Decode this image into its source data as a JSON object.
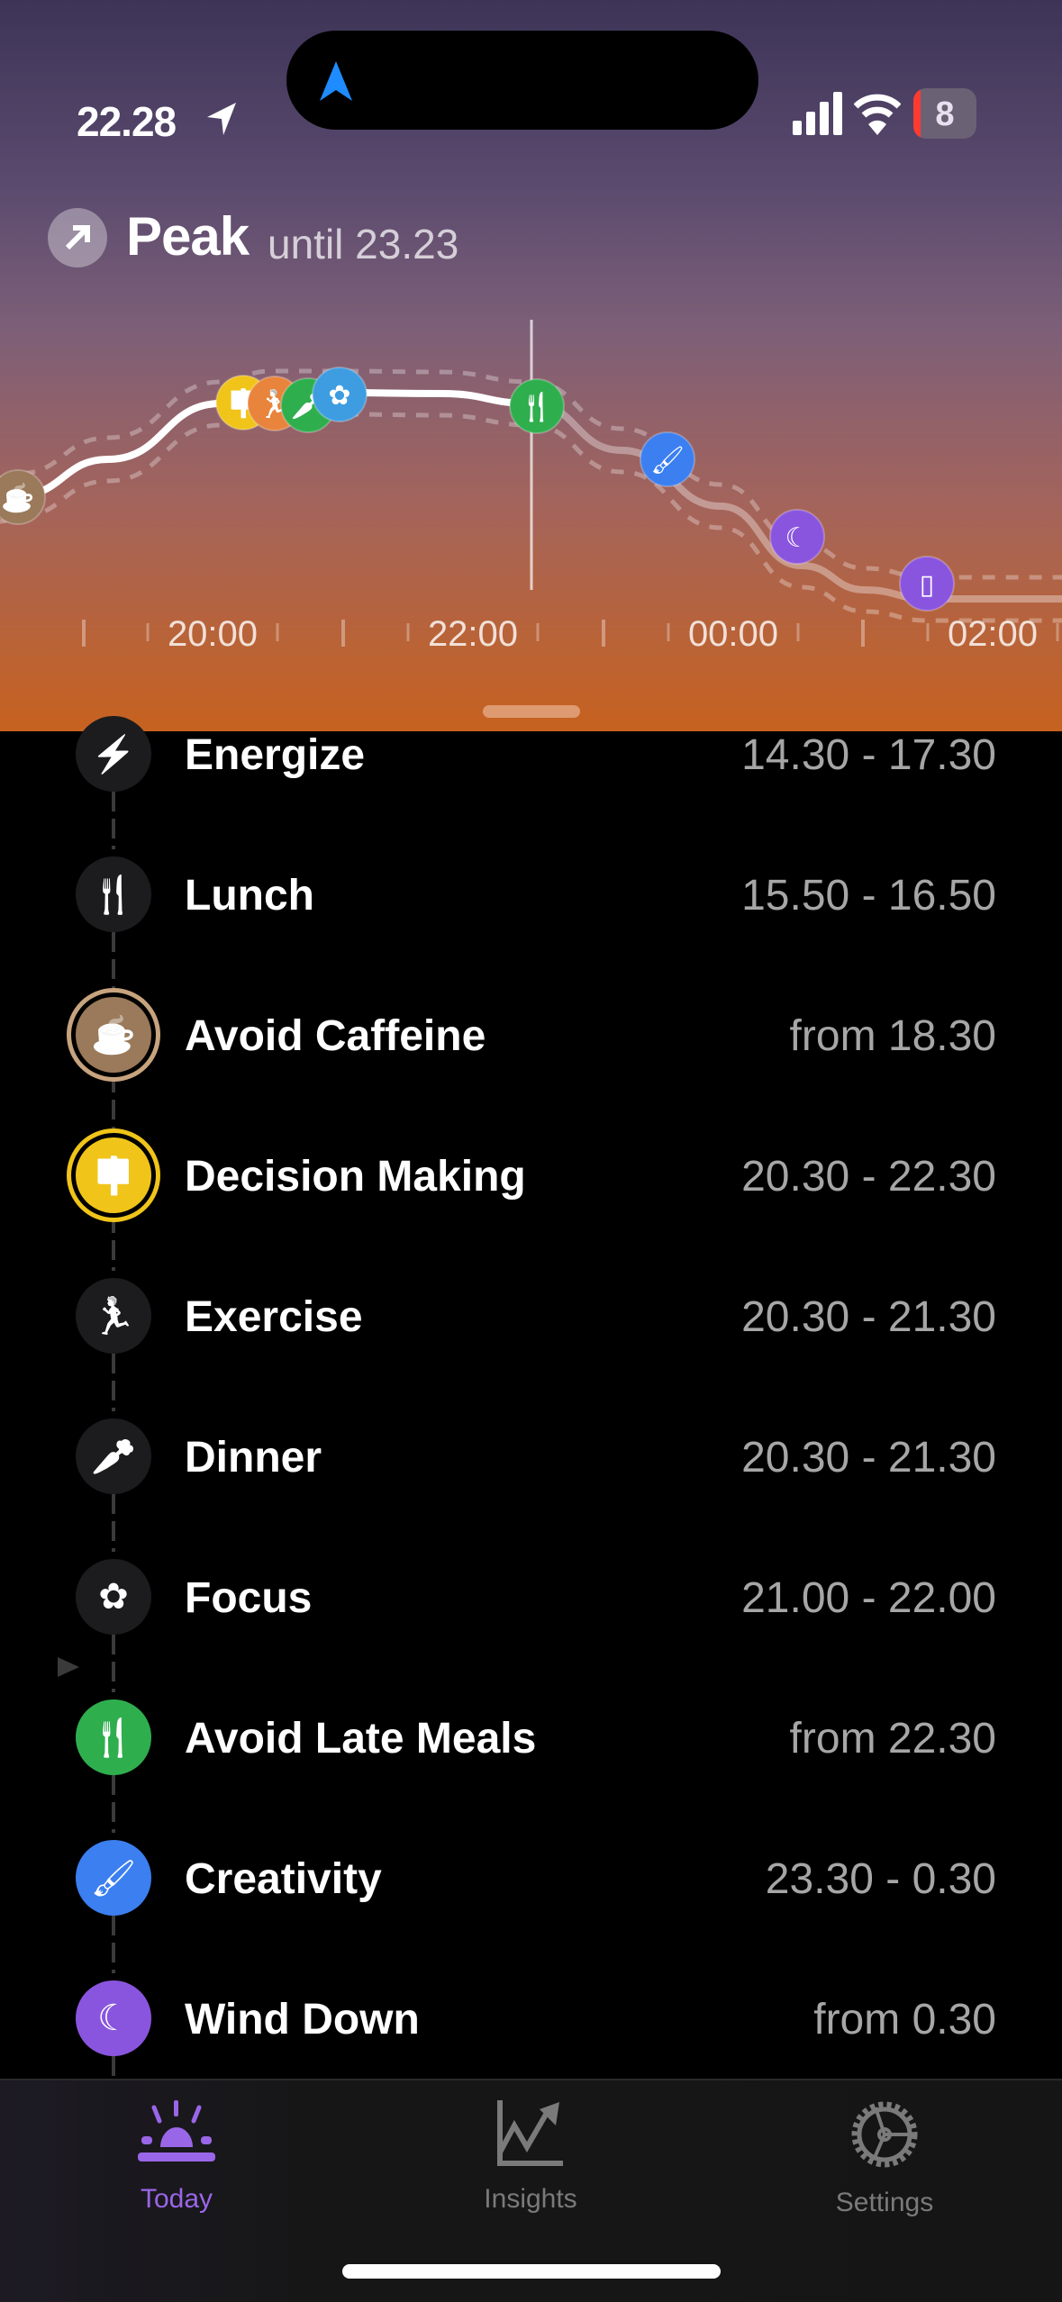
{
  "status_bar": {
    "time": "22.28",
    "battery": "8"
  },
  "header": {
    "title": "Peak",
    "subtitle": "until 23.23"
  },
  "chart": {
    "ticks": [
      "20:00",
      "22:00",
      "00:00",
      "02:00"
    ],
    "now": "22.28",
    "markers": [
      {
        "name": "avoid-caffeine",
        "color": "#9a7a5a",
        "icon": "cup-icon"
      },
      {
        "name": "decision-making",
        "color": "#f0c419",
        "icon": "signpost-icon"
      },
      {
        "name": "exercise",
        "color": "#e8843c",
        "icon": "runner-icon"
      },
      {
        "name": "dinner",
        "color": "#2fae4e",
        "icon": "carrot-icon"
      },
      {
        "name": "focus",
        "color": "#3d9de0",
        "icon": "brain-icon"
      },
      {
        "name": "avoid-late-meals",
        "color": "#2fae4e",
        "icon": "fork-knife-icon"
      },
      {
        "name": "creativity",
        "color": "#3b7ff0",
        "icon": "brush-icon"
      },
      {
        "name": "wind-down",
        "color": "#8a55de",
        "icon": "moon-icon"
      },
      {
        "name": "screen-time",
        "color": "#8a55de",
        "icon": "phone-icon"
      }
    ]
  },
  "list": [
    {
      "label": "Energize",
      "time": "14.30 - 17.30",
      "icon": "bolt-icon",
      "bg": "#1c1c1e"
    },
    {
      "label": "Lunch",
      "time": "15.50 - 16.50",
      "icon": "fork-knife-icon",
      "bg": "#1c1c1e"
    },
    {
      "label": "Avoid Caffeine",
      "time": "from 18.30",
      "icon": "no-cup-icon",
      "bg": "#9a7a5a",
      "ring": "#c7a37e"
    },
    {
      "label": "Decision Making",
      "time": "20.30 - 22.30",
      "icon": "signpost-icon",
      "bg": "#f0c419",
      "ring": "#f0c419"
    },
    {
      "label": "Exercise",
      "time": "20.30 - 21.30",
      "icon": "runner-icon",
      "bg": "#1c1c1e"
    },
    {
      "label": "Dinner",
      "time": "20.30 - 21.30",
      "icon": "carrot-icon",
      "bg": "#1c1c1e"
    },
    {
      "label": "Focus",
      "time": "21.00 - 22.00",
      "icon": "brain-icon",
      "bg": "#1c1c1e"
    },
    {
      "label": "Avoid Late Meals",
      "time": "from 22.30",
      "icon": "no-fork-icon",
      "bg": "#2fae4e"
    },
    {
      "label": "Creativity",
      "time": "23.30 - 0.30",
      "icon": "brush-icon",
      "bg": "#3b7ff0"
    },
    {
      "label": "Wind Down",
      "time": "from 0.30",
      "icon": "moon-icon",
      "bg": "#8a55de"
    }
  ],
  "tabs": [
    {
      "label": "Today",
      "active": true
    },
    {
      "label": "Insights"
    },
    {
      "label": "Settings"
    }
  ],
  "colors": {
    "accent": "#9a66e8",
    "inactive": "#7a7a7a"
  }
}
